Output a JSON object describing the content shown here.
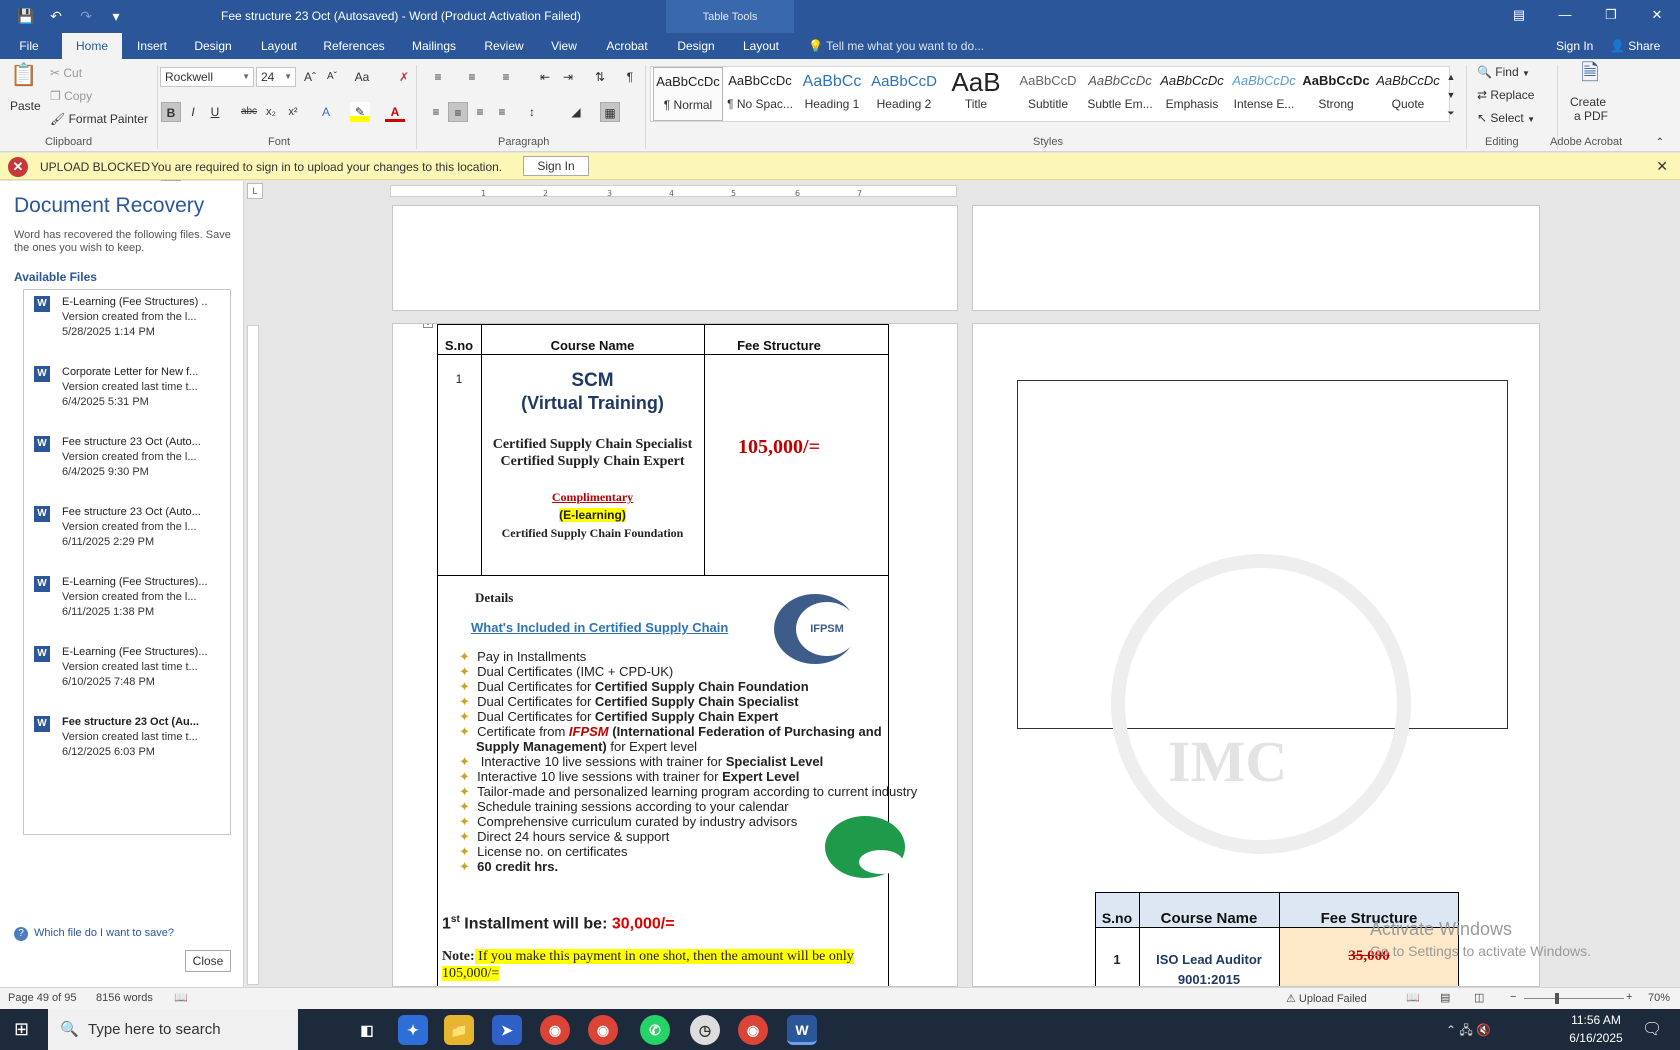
{
  "window": {
    "title": "Fee structure 23 Oct (Autosaved) - Word (Product Activation Failed)",
    "contextual_tab_group": "Table Tools"
  },
  "ribbon_tabs": [
    "File",
    "Home",
    "Insert",
    "Design",
    "Layout",
    "References",
    "Mailings",
    "Review",
    "View",
    "Acrobat",
    "Design",
    "Layout"
  ],
  "tell_me": "Tell me what you want to do...",
  "account": {
    "sign_in": "Sign In",
    "share": "Share"
  },
  "clipboard": {
    "paste": "Paste",
    "cut": "Cut",
    "copy": "Copy",
    "format_painter": "Format Painter",
    "label": "Clipboard"
  },
  "font": {
    "name": "Rockwell",
    "size": "24",
    "label": "Font"
  },
  "paragraph": {
    "label": "Paragraph"
  },
  "styles": {
    "label": "Styles",
    "items": [
      {
        "preview": "AaBbCcDc",
        "name": "¶ Normal"
      },
      {
        "preview": "AaBbCcDc",
        "name": "¶ No Spac..."
      },
      {
        "preview": "AaBbCc",
        "name": "Heading 1"
      },
      {
        "preview": "AaBbCcD",
        "name": "Heading 2"
      },
      {
        "preview": "AaB",
        "name": "Title"
      },
      {
        "preview": "AaBbCcD",
        "name": "Subtitle"
      },
      {
        "preview": "AaBbCcDc",
        "name": "Subtle Em..."
      },
      {
        "preview": "AaBbCcDc",
        "name": "Emphasis"
      },
      {
        "preview": "AaBbCcDc",
        "name": "Intense E..."
      },
      {
        "preview": "AaBbCcDc",
        "name": "Strong"
      },
      {
        "preview": "AaBbCcDc",
        "name": "Quote"
      }
    ]
  },
  "editing": {
    "find": "Find",
    "replace": "Replace",
    "select": "Select",
    "label": "Editing"
  },
  "acrobat": {
    "create_pdf_1": "Create",
    "create_pdf_2": "a PDF",
    "label": "Adobe Acrobat"
  },
  "message_bar": {
    "title": "UPLOAD BLOCKED",
    "text": "You are required to sign in to upload your changes to this location.",
    "button": "Sign In"
  },
  "recovery": {
    "title": "Document Recovery",
    "description": "Word has recovered the following files. Save the ones you wish to keep.",
    "available": "Available Files",
    "files": [
      {
        "name": "E-Learning (Fee Structures) ..",
        "version": "Version created from the l...",
        "date": "5/28/2025 1:14 PM"
      },
      {
        "name": "Corporate Letter for New f...",
        "version": "Version created last time t...",
        "date": "6/4/2025 5:31 PM"
      },
      {
        "name": "Fee structure 23 Oct (Auto...",
        "version": "Version created from the l...",
        "date": "6/4/2025 9:30 PM"
      },
      {
        "name": "Fee structure 23 Oct (Auto...",
        "version": "Version created from the l...",
        "date": "6/11/2025 2:29 PM"
      },
      {
        "name": "E-Learning (Fee Structures)...",
        "version": "Version created from the l...",
        "date": "6/11/2025 1:38 PM"
      },
      {
        "name": "E-Learning (Fee Structures)...",
        "version": "Version created last time t...",
        "date": "6/10/2025 7:48 PM"
      },
      {
        "name": "Fee structure 23 Oct (Au...",
        "version": "Version created last time t...",
        "date": "6/12/2025 6:03 PM"
      }
    ],
    "help": "Which file do I want to save?",
    "close": "Close"
  },
  "doc": {
    "table_headers": [
      "S.no",
      "Course Name",
      "Fee Structure"
    ],
    "row_no": "1",
    "course_title": "SCM",
    "course_subtitle": "(Virtual Training)",
    "cert1": "Certified Supply Chain Specialist",
    "cert2": "Certified Supply Chain Expert",
    "complimentary": "Complimentary",
    "elearning": "(E-learning)",
    "cert3": "Certified Supply Chain Foundation",
    "fee": "105,000/=",
    "details": "Details",
    "whats_included": "What's Included in Certified Supply Chain",
    "ifpsm_logo": "IFPSM",
    "bullets": [
      {
        "pre": "Pay in Installments",
        "bold": "",
        "post": ""
      },
      {
        "pre": "Dual Certificates (IMC + CPD-UK)",
        "bold": "",
        "post": ""
      },
      {
        "pre": "Dual Certificates for ",
        "bold": "Certified Supply Chain Foundation",
        "post": ""
      },
      {
        "pre": "Dual Certificates for ",
        "bold": "Certified Supply Chain Specialist",
        "post": ""
      },
      {
        "pre": "Dual Certificates for ",
        "bold": "Certified Supply Chain Expert",
        "post": ""
      }
    ],
    "ifpsm_line_pre": "Certificate from ",
    "ifpsm_line_red": "IFPSM",
    "ifpsm_line_bold": " (International Federation of Purchasing and",
    "ifpsm_line2_bold": "Supply Management)",
    "ifpsm_line2_post": " for Expert level",
    "bullets2": [
      {
        "pre": " Interactive 10 live sessions with trainer for ",
        "bold": "Specialist Level"
      },
      {
        "pre": "Interactive 10 live sessions with trainer for ",
        "bold": "Expert Level"
      },
      {
        "pre": "Tailor-made and personalized learning program according to current industry",
        "bold": ""
      },
      {
        "pre": "Schedule training sessions according to your calendar",
        "bold": ""
      },
      {
        "pre": "Comprehensive curriculum curated by industry advisors",
        "bold": ""
      },
      {
        "pre": "Direct 24 hours service & support",
        "bold": ""
      },
      {
        "pre": "License no. on certificates",
        "bold": ""
      },
      {
        "pre": "",
        "bold": "60 credit hrs."
      }
    ],
    "installment_pre": "1",
    "installment_sup": "st",
    "installment_text": " Installment will be: ",
    "installment_amount": "30,000/=",
    "note_label": "Note:",
    "note_text": " If you make this payment in one shot, then the amount will be only",
    "note_text2": "105,000/="
  },
  "page2": {
    "watermark": "IMC",
    "table_headers": [
      "S.no",
      "Course Name",
      "Fee Structure"
    ],
    "row_no": "1",
    "course": "ISO Lead Auditor",
    "course2": "9001:2015",
    "fee": "35,000"
  },
  "activate": {
    "title": "Activate Windows",
    "subtitle": "Go to Settings to activate Windows."
  },
  "status": {
    "page": "Page 49 of 95",
    "words": "8156 words",
    "upload": "Upload Failed",
    "zoom": "70%"
  },
  "taskbar": {
    "search": "Type here to search",
    "time": "11:56 AM",
    "date": "6/16/2025"
  }
}
